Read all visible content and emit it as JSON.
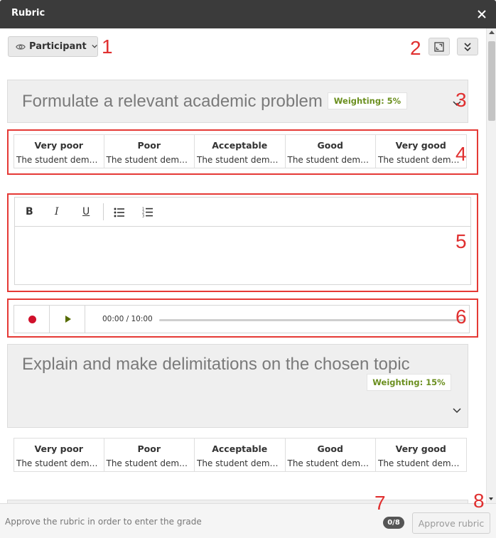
{
  "window": {
    "title": "Rubric",
    "close_icon": "close-icon"
  },
  "toolbar": {
    "view_selector_label": "Participant",
    "view_selector_icon": "eye-icon",
    "expand_icon": "expand-icon",
    "collapse_all_icon": "double-chevron-down-icon"
  },
  "annotations": [
    "1",
    "2",
    "3",
    "4",
    "5",
    "6",
    "7",
    "8"
  ],
  "criteria": [
    {
      "title": "Formulate a relevant academic problem",
      "weighting": "Weighting: 5%",
      "levels": [
        {
          "name": "Very poor",
          "desc": "The student demonstrates"
        },
        {
          "name": "Poor",
          "desc": "The student demonstrates"
        },
        {
          "name": "Acceptable",
          "desc": "The student demonstrates"
        },
        {
          "name": "Good",
          "desc": "The student demonstrates"
        },
        {
          "name": "Very good",
          "desc": "The student demonstrates"
        }
      ]
    },
    {
      "title": "Explain and make delimitations on the chosen topic",
      "weighting": "Weighting: 15%",
      "levels": [
        {
          "name": "Very poor",
          "desc": "The student demonstrates"
        },
        {
          "name": "Poor",
          "desc": "The student demonstrates"
        },
        {
          "name": "Acceptable",
          "desc": "The student demonstrates"
        },
        {
          "name": "Good",
          "desc": "The student demonstrates"
        },
        {
          "name": "Very good",
          "desc": "The student demonstrates"
        }
      ]
    }
  ],
  "editor": {
    "bold": "B",
    "italic": "I",
    "underline": "U",
    "bullet_list_icon": "bullet-list-icon",
    "numbered_list_icon": "numbered-list-icon",
    "value": ""
  },
  "audio": {
    "time": "00:00 / 10:00",
    "progress": 0
  },
  "footer": {
    "note": "Approve the rubric in order to enter the grade",
    "count": "0/8",
    "approve_label": "Approve rubric"
  },
  "colors": {
    "titlebar": "#3b3b3b",
    "annotation_red": "#e53935",
    "weighting_green": "#6b8f1f",
    "record_red": "#d0102b"
  }
}
